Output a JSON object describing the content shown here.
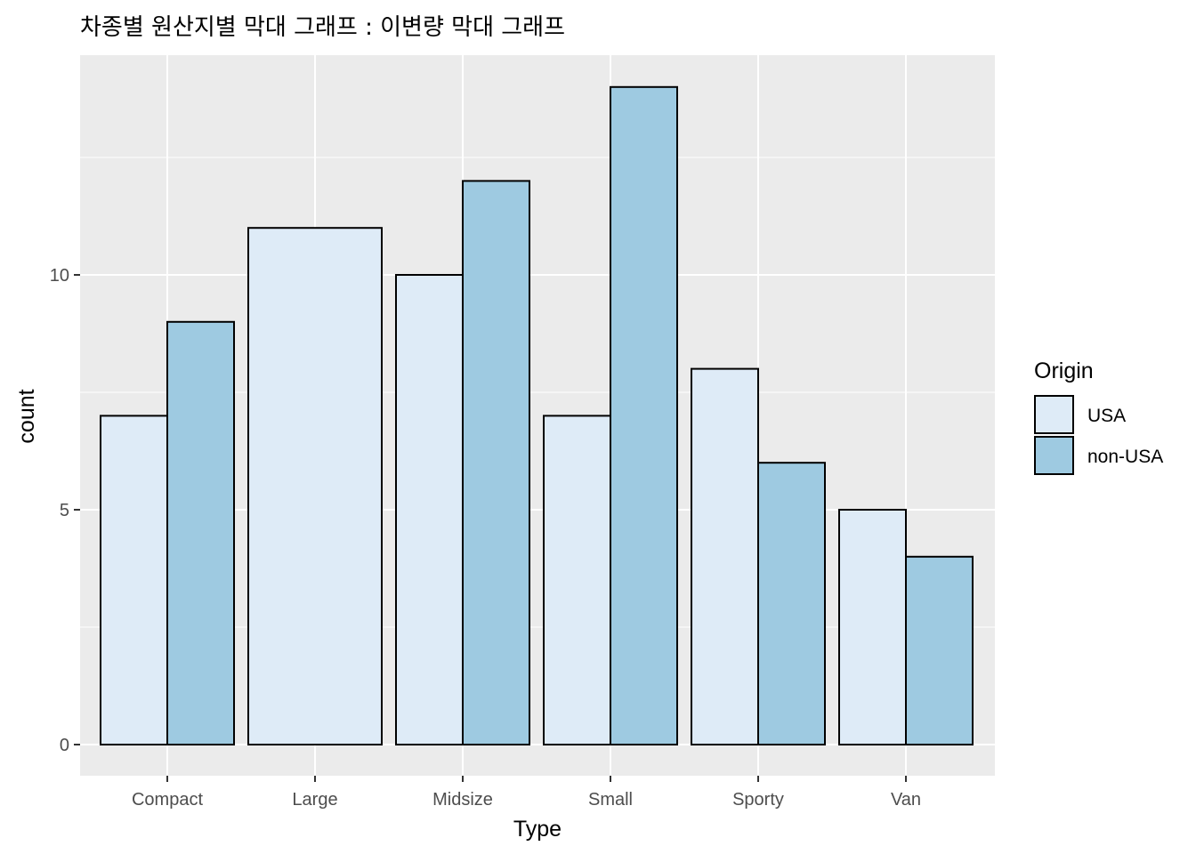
{
  "chart_data": {
    "type": "bar",
    "title": "차종별 원산지별 막대 그래프 : 이변량 막대 그래프",
    "xlabel": "Type",
    "ylabel": "count",
    "categories": [
      "Compact",
      "Large",
      "Midsize",
      "Small",
      "Sporty",
      "Van"
    ],
    "series": [
      {
        "name": "USA",
        "color": "#deebf7",
        "values": [
          7,
          11,
          10,
          7,
          8,
          5
        ]
      },
      {
        "name": "non-USA",
        "color": "#9ecae1",
        "values": [
          9,
          0,
          12,
          14,
          6,
          4
        ]
      }
    ],
    "ylim": [
      0,
      14.7
    ],
    "yticks": [
      0,
      5,
      10
    ],
    "grid": true,
    "legend": {
      "title": "Origin",
      "placement": "right",
      "entries": [
        "USA",
        "non-USA"
      ]
    },
    "colors": {
      "panel": "#ebebeb",
      "grid": "#ffffff",
      "outline": "#000000"
    }
  }
}
